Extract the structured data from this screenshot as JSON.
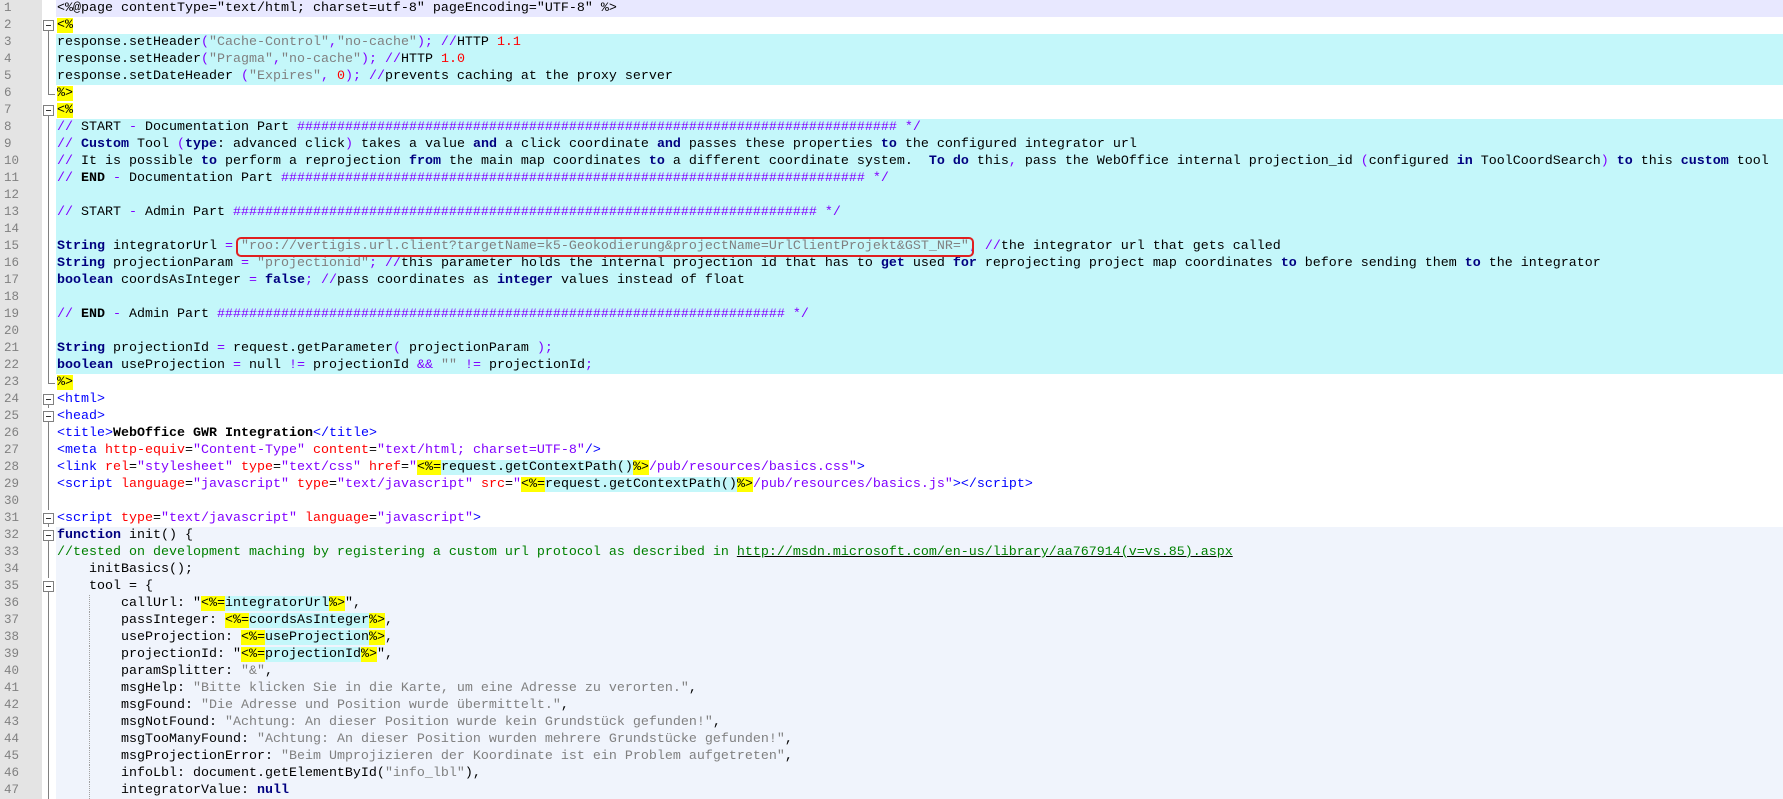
{
  "colors": {
    "page": "#e8e8ff",
    "jsp": "#c4f7fa",
    "white": "#ffffff",
    "script": "#f0f4fc",
    "highlight_box": "#e02020"
  },
  "lines": [
    {
      "n": "1",
      "bg": "page",
      "f": "none",
      "t": [
        [
          "<%@page contentType=\"text/html; charset=utf-8\" pageEncoding=\"UTF-8\" %>",
          "p"
        ]
      ]
    },
    {
      "n": "2",
      "bg": "white",
      "f": "open",
      "t": [
        [
          "<%",
          "y"
        ]
      ]
    },
    {
      "n": "3",
      "bg": "jsp",
      "f": "line",
      "t": [
        [
          "response.setHeader",
          "p"
        ],
        [
          "(",
          "o"
        ],
        [
          "\"Cache-Control\"",
          "s"
        ],
        [
          ",",
          "o"
        ],
        [
          "\"no-cache\"",
          "s"
        ],
        [
          ");",
          "o"
        ],
        [
          " //",
          "o"
        ],
        [
          "HTTP ",
          "p"
        ],
        [
          "1.1",
          "n"
        ]
      ]
    },
    {
      "n": "4",
      "bg": "jsp",
      "f": "line",
      "t": [
        [
          "response.setHeader",
          "p"
        ],
        [
          "(",
          "o"
        ],
        [
          "\"Pragma\"",
          "s"
        ],
        [
          ",",
          "o"
        ],
        [
          "\"no-cache\"",
          "s"
        ],
        [
          ");",
          "o"
        ],
        [
          " //",
          "o"
        ],
        [
          "HTTP ",
          "p"
        ],
        [
          "1.0",
          "n"
        ]
      ]
    },
    {
      "n": "5",
      "bg": "jsp",
      "f": "line",
      "t": [
        [
          "response.setDateHeader ",
          "p"
        ],
        [
          "(",
          "o"
        ],
        [
          "\"Expires\"",
          "s"
        ],
        [
          ", ",
          "o"
        ],
        [
          "0",
          "n"
        ],
        [
          ");",
          "o"
        ],
        [
          " //",
          "o"
        ],
        [
          "prevents caching at the proxy server",
          "p"
        ]
      ]
    },
    {
      "n": "6",
      "bg": "white",
      "f": "end",
      "t": [
        [
          "%>",
          "y"
        ]
      ]
    },
    {
      "n": "7",
      "bg": "white",
      "f": "open",
      "t": [
        [
          "<%",
          "y"
        ]
      ]
    },
    {
      "n": "8",
      "bg": "jsp",
      "f": "line",
      "t": [
        [
          "//",
          "o"
        ],
        [
          " START ",
          "p"
        ],
        [
          "-",
          "o"
        ],
        [
          " Documentation Part ",
          "p"
        ],
        [
          "########################################################################### */",
          "h"
        ]
      ]
    },
    {
      "n": "9",
      "bg": "jsp",
      "f": "line",
      "t": [
        [
          "//",
          "o"
        ],
        [
          " ",
          "p"
        ],
        [
          "Custom",
          "k"
        ],
        [
          " Tool ",
          "p"
        ],
        [
          "(",
          "o"
        ],
        [
          "type",
          "k"
        ],
        [
          ": advanced click",
          "p"
        ],
        [
          ")",
          "o"
        ],
        [
          " takes a value ",
          "p"
        ],
        [
          "and",
          "k"
        ],
        [
          " a click coordinate ",
          "p"
        ],
        [
          "and",
          "k"
        ],
        [
          " passes these properties ",
          "p"
        ],
        [
          "to",
          "k"
        ],
        [
          " the configured integrator url",
          "p"
        ]
      ]
    },
    {
      "n": "10",
      "bg": "jsp",
      "f": "line",
      "t": [
        [
          "//",
          "o"
        ],
        [
          " It is possible ",
          "p"
        ],
        [
          "to",
          "k"
        ],
        [
          " perform a reprojection ",
          "p"
        ],
        [
          "from",
          "k"
        ],
        [
          " the main map coordinates ",
          "p"
        ],
        [
          "to",
          "k"
        ],
        [
          " a different coordinate system.  ",
          "p"
        ],
        [
          "To do",
          "k"
        ],
        [
          " this",
          "p"
        ],
        [
          ",",
          "o"
        ],
        [
          " pass the WebOffice internal projection_id ",
          "p"
        ],
        [
          "(",
          "o"
        ],
        [
          "configured ",
          "p"
        ],
        [
          "in",
          "k"
        ],
        [
          " ToolCoordSearch",
          "p"
        ],
        [
          ")",
          "o"
        ],
        [
          " ",
          "p"
        ],
        [
          "to",
          "k"
        ],
        [
          " this ",
          "p"
        ],
        [
          "custom",
          "k"
        ],
        [
          " tool",
          "p"
        ]
      ]
    },
    {
      "n": "11",
      "bg": "jsp",
      "f": "line",
      "t": [
        [
          "//",
          "o"
        ],
        [
          " ",
          "p"
        ],
        [
          "END",
          "b"
        ],
        [
          " ",
          "p"
        ],
        [
          "-",
          "o"
        ],
        [
          " Documentation Part ",
          "p"
        ],
        [
          "######################################################################### */",
          "h"
        ]
      ]
    },
    {
      "n": "12",
      "bg": "jsp",
      "f": "line",
      "t": []
    },
    {
      "n": "13",
      "bg": "jsp",
      "f": "line",
      "t": [
        [
          "//",
          "o"
        ],
        [
          " START ",
          "p"
        ],
        [
          "-",
          "o"
        ],
        [
          " Admin Part ",
          "p"
        ],
        [
          "######################################################################### */",
          "h"
        ]
      ]
    },
    {
      "n": "14",
      "bg": "jsp",
      "f": "line",
      "t": []
    },
    {
      "n": "15",
      "bg": "jsp",
      "f": "line",
      "t": [
        [
          "String",
          "k"
        ],
        [
          " integratorUrl ",
          "p"
        ],
        [
          "=",
          "o"
        ],
        [
          " ",
          "p"
        ],
        [
          "\"roo://vertigis.url.client?targetName=k5-Geokodierung&projectName=UrlClientProjekt&GST_NR=\"",
          "s"
        ],
        [
          ";",
          "o"
        ],
        [
          " //",
          "o"
        ],
        [
          "the integrator url that gets called",
          "p"
        ]
      ]
    },
    {
      "n": "16",
      "bg": "jsp",
      "f": "line",
      "t": [
        [
          "String",
          "k"
        ],
        [
          " projectionParam ",
          "p"
        ],
        [
          "=",
          "o"
        ],
        [
          " \"projectionid\"",
          "s"
        ],
        [
          ";",
          "o"
        ],
        [
          " //",
          "o"
        ],
        [
          "this parameter holds the internal projection id that has to ",
          "p"
        ],
        [
          "get",
          "k"
        ],
        [
          " used ",
          "p"
        ],
        [
          "for",
          "k"
        ],
        [
          " reprojecting project map coordinates ",
          "p"
        ],
        [
          "to",
          "k"
        ],
        [
          " before sending them ",
          "p"
        ],
        [
          "to",
          "k"
        ],
        [
          " the integrator",
          "p"
        ]
      ]
    },
    {
      "n": "17",
      "bg": "jsp",
      "f": "line",
      "t": [
        [
          "boolean",
          "k"
        ],
        [
          " coordsAsInteger ",
          "p"
        ],
        [
          "=",
          "o"
        ],
        [
          " ",
          "p"
        ],
        [
          "false",
          "k"
        ],
        [
          ";",
          "o"
        ],
        [
          " //",
          "o"
        ],
        [
          "pass coordinates as ",
          "p"
        ],
        [
          "integer",
          "k"
        ],
        [
          " values instead of float",
          "p"
        ]
      ]
    },
    {
      "n": "18",
      "bg": "jsp",
      "f": "line",
      "t": []
    },
    {
      "n": "19",
      "bg": "jsp",
      "f": "line",
      "t": [
        [
          "//",
          "o"
        ],
        [
          " ",
          "p"
        ],
        [
          "END",
          "b"
        ],
        [
          " ",
          "p"
        ],
        [
          "-",
          "o"
        ],
        [
          " Admin Part ",
          "p"
        ],
        [
          "####################################################################### */",
          "h"
        ]
      ]
    },
    {
      "n": "20",
      "bg": "jsp",
      "f": "line",
      "t": []
    },
    {
      "n": "21",
      "bg": "jsp",
      "f": "line",
      "t": [
        [
          "String",
          "k"
        ],
        [
          " projectionId ",
          "p"
        ],
        [
          "=",
          "o"
        ],
        [
          " request.getParameter",
          "p"
        ],
        [
          "(",
          "o"
        ],
        [
          " projectionParam ",
          "p"
        ],
        [
          ");",
          "o"
        ]
      ]
    },
    {
      "n": "22",
      "bg": "jsp",
      "f": "line",
      "t": [
        [
          "boolean",
          "k"
        ],
        [
          " useProjection ",
          "p"
        ],
        [
          "=",
          "o"
        ],
        [
          " null ",
          "p"
        ],
        [
          "!=",
          "o"
        ],
        [
          " projectionId ",
          "p"
        ],
        [
          "&&",
          "o"
        ],
        [
          " ",
          "p"
        ],
        [
          "\"\"",
          "s"
        ],
        [
          " ",
          "p"
        ],
        [
          "!=",
          "o"
        ],
        [
          " projectionId",
          "p"
        ],
        [
          ";",
          "o"
        ]
      ]
    },
    {
      "n": "23",
      "bg": "white",
      "f": "end",
      "t": [
        [
          "%>",
          "y"
        ]
      ]
    },
    {
      "n": "24",
      "bg": "white",
      "f": "open",
      "t": [
        [
          "<html>",
          "t"
        ]
      ]
    },
    {
      "n": "25",
      "bg": "white",
      "f": "open",
      "t": [
        [
          "<head>",
          "t"
        ]
      ]
    },
    {
      "n": "26",
      "bg": "white",
      "f": "line",
      "t": [
        [
          "<title>",
          "t"
        ],
        [
          "WebOffice GWR Integration",
          "b"
        ],
        [
          "</title>",
          "t"
        ]
      ]
    },
    {
      "n": "27",
      "bg": "white",
      "f": "line",
      "t": [
        [
          "<meta ",
          "t"
        ],
        [
          "http-equiv",
          "a"
        ],
        [
          "=",
          "p"
        ],
        [
          "\"Content-Type\"",
          "v"
        ],
        [
          " ",
          "p"
        ],
        [
          "content",
          "a"
        ],
        [
          "=",
          "p"
        ],
        [
          "\"text/html; charset=UTF-8\"",
          "v"
        ],
        [
          "/>",
          "t"
        ]
      ]
    },
    {
      "n": "28",
      "bg": "white",
      "f": "line",
      "t": [
        [
          "<link ",
          "t"
        ],
        [
          "rel",
          "a"
        ],
        [
          "=",
          "p"
        ],
        [
          "\"stylesheet\"",
          "v"
        ],
        [
          " ",
          "p"
        ],
        [
          "type",
          "a"
        ],
        [
          "=",
          "p"
        ],
        [
          "\"text/css\"",
          "v"
        ],
        [
          " ",
          "p"
        ],
        [
          "href",
          "a"
        ],
        [
          "=",
          "p"
        ],
        [
          "\"",
          "v"
        ],
        [
          "<%=",
          "y"
        ],
        [
          "request.getContextPath()",
          "e"
        ],
        [
          "%>",
          "y"
        ],
        [
          "/pub/resources/basics.css\"",
          "v"
        ],
        [
          ">",
          "t"
        ]
      ]
    },
    {
      "n": "29",
      "bg": "white",
      "f": "line",
      "t": [
        [
          "<script ",
          "t"
        ],
        [
          "language",
          "a"
        ],
        [
          "=",
          "p"
        ],
        [
          "\"javascript\"",
          "v"
        ],
        [
          " ",
          "p"
        ],
        [
          "type",
          "a"
        ],
        [
          "=",
          "p"
        ],
        [
          "\"text/javascript\"",
          "v"
        ],
        [
          " ",
          "p"
        ],
        [
          "src",
          "a"
        ],
        [
          "=",
          "p"
        ],
        [
          "\"",
          "v"
        ],
        [
          "<%=",
          "y"
        ],
        [
          "request.getContextPath()",
          "e"
        ],
        [
          "%>",
          "y"
        ],
        [
          "/pub/resources/basics.js\"",
          "v"
        ],
        [
          "></script>",
          "t"
        ]
      ]
    },
    {
      "n": "30",
      "bg": "white",
      "f": "line",
      "t": []
    },
    {
      "n": "31",
      "bg": "white",
      "f": "open",
      "t": [
        [
          "<script ",
          "t"
        ],
        [
          "type",
          "a"
        ],
        [
          "=",
          "p"
        ],
        [
          "\"text/javascript\"",
          "v"
        ],
        [
          " ",
          "p"
        ],
        [
          "language",
          "a"
        ],
        [
          "=",
          "p"
        ],
        [
          "\"javascript\"",
          "v"
        ],
        [
          ">",
          "t"
        ]
      ]
    },
    {
      "n": "32",
      "bg": "script",
      "f": "open",
      "t": [
        [
          "function",
          "k"
        ],
        [
          " init() {",
          "p"
        ]
      ]
    },
    {
      "n": "33",
      "bg": "script",
      "f": "line",
      "t": [
        [
          "//tested on development maching by registering a custom url protocol as described in ",
          "g"
        ],
        [
          "http://msdn.microsoft.com/en-us/library/aa767914(v=vs.85).aspx",
          "u"
        ]
      ]
    },
    {
      "n": "34",
      "bg": "script",
      "f": "line",
      "t": [
        [
          "    initBasics();",
          "p"
        ]
      ]
    },
    {
      "n": "35",
      "bg": "script",
      "f": "open",
      "t": [
        [
          "    tool = {",
          "p"
        ]
      ]
    },
    {
      "n": "36",
      "bg": "script",
      "f": "line",
      "g": true,
      "t": [
        [
          "        callUrl: \"",
          "p"
        ],
        [
          "<%=",
          "y"
        ],
        [
          "integratorUrl",
          "e"
        ],
        [
          "%>",
          "y"
        ],
        [
          "\",",
          "p"
        ]
      ]
    },
    {
      "n": "37",
      "bg": "script",
      "f": "line",
      "g": true,
      "t": [
        [
          "        passInteger: ",
          "p"
        ],
        [
          "<%=",
          "y"
        ],
        [
          "coordsAsInteger",
          "e"
        ],
        [
          "%>",
          "y"
        ],
        [
          ",",
          "p"
        ]
      ]
    },
    {
      "n": "38",
      "bg": "script",
      "f": "line",
      "g": true,
      "t": [
        [
          "        useProjection: ",
          "p"
        ],
        [
          "<%=",
          "y"
        ],
        [
          "useProjection",
          "e"
        ],
        [
          "%>",
          "y"
        ],
        [
          ",",
          "p"
        ]
      ]
    },
    {
      "n": "39",
      "bg": "script",
      "f": "line",
      "g": true,
      "t": [
        [
          "        projectionId: \"",
          "p"
        ],
        [
          "<%=",
          "y"
        ],
        [
          "projectionId",
          "e"
        ],
        [
          "%>",
          "y"
        ],
        [
          "\",",
          "p"
        ]
      ]
    },
    {
      "n": "40",
      "bg": "script",
      "f": "line",
      "g": true,
      "t": [
        [
          "        paramSplitter: ",
          "p"
        ],
        [
          "\"&\"",
          "s"
        ],
        [
          ",",
          "p"
        ]
      ]
    },
    {
      "n": "41",
      "bg": "script",
      "f": "line",
      "g": true,
      "t": [
        [
          "        msgHelp: ",
          "p"
        ],
        [
          "\"Bitte klicken Sie in die Karte, um eine Adresse zu verorten.\"",
          "s"
        ],
        [
          ",",
          "p"
        ]
      ]
    },
    {
      "n": "42",
      "bg": "script",
      "f": "line",
      "g": true,
      "t": [
        [
          "        msgFound: ",
          "p"
        ],
        [
          "\"Die Adresse und Position wurde übermittelt.\"",
          "s"
        ],
        [
          ",",
          "p"
        ]
      ]
    },
    {
      "n": "43",
      "bg": "script",
      "f": "line",
      "g": true,
      "t": [
        [
          "        msgNotFound: ",
          "p"
        ],
        [
          "\"Achtung: An dieser Position wurde kein Grundstück gefunden!\"",
          "s"
        ],
        [
          ",",
          "p"
        ]
      ]
    },
    {
      "n": "44",
      "bg": "script",
      "f": "line",
      "g": true,
      "t": [
        [
          "        msgTooManyFound: ",
          "p"
        ],
        [
          "\"Achtung: An dieser Position wurden mehrere Grundstücke gefunden!\"",
          "s"
        ],
        [
          ",",
          "p"
        ]
      ]
    },
    {
      "n": "45",
      "bg": "script",
      "f": "line",
      "g": true,
      "t": [
        [
          "        msgProjectionError: ",
          "p"
        ],
        [
          "\"Beim Umprojizieren der Koordinate ist ein Problem aufgetreten\"",
          "s"
        ],
        [
          ",",
          "p"
        ]
      ]
    },
    {
      "n": "46",
      "bg": "script",
      "f": "line",
      "g": true,
      "t": [
        [
          "        infoLbl: document.getElementById(",
          "p"
        ],
        [
          "\"info_lbl\"",
          "s"
        ],
        [
          "),",
          "p"
        ]
      ]
    },
    {
      "n": "47",
      "bg": "script",
      "f": "line",
      "g": true,
      "t": [
        [
          "        integratorValue: ",
          "p"
        ],
        [
          "null",
          "k"
        ]
      ]
    }
  ]
}
